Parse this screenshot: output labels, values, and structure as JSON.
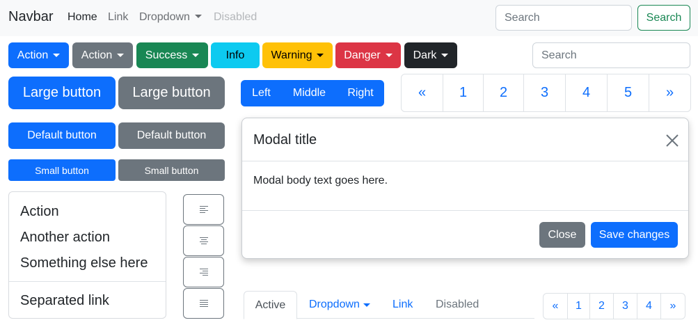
{
  "navbar": {
    "brand": "Navbar",
    "links": [
      {
        "label": "Home",
        "state": "active"
      },
      {
        "label": "Link",
        "state": "normal"
      },
      {
        "label": "Dropdown",
        "state": "dropdown"
      },
      {
        "label": "Disabled",
        "state": "disabled"
      }
    ],
    "search_placeholder": "Search",
    "search_button": "Search"
  },
  "dropdown_buttons": [
    "Action",
    "Action",
    "Success",
    "Info",
    "Warning",
    "Danger",
    "Dark"
  ],
  "search2_placeholder": "Search",
  "sized_buttons": {
    "large_primary": "Large button",
    "large_secondary": "Large button",
    "default_primary": "Default button",
    "default_secondary": "Default button",
    "small_primary": "Small button",
    "small_secondary": "Small button"
  },
  "button_group": [
    "Left",
    "Middle",
    "Right"
  ],
  "pagination_large": [
    "«",
    "1",
    "2",
    "3",
    "4",
    "5",
    "»"
  ],
  "pagination_small": [
    "«",
    "1",
    "2",
    "3",
    "4",
    "»"
  ],
  "dropdown_menu": {
    "items": [
      "Action",
      "Another action",
      "Something else here"
    ],
    "separated": "Separated link"
  },
  "align_icons": [
    "align-left-icon",
    "align-center-icon",
    "align-right-icon",
    "align-justify-icon"
  ],
  "modal": {
    "title": "Modal title",
    "body": "Modal body text goes here.",
    "close_label": "Close",
    "save_label": "Save changes"
  },
  "tabs": [
    {
      "label": "Active",
      "state": "active"
    },
    {
      "label": "Dropdown",
      "state": "dropdown"
    },
    {
      "label": "Link",
      "state": "normal"
    },
    {
      "label": "Disabled",
      "state": "disabled"
    }
  ],
  "colors": {
    "primary": "#0d6efd",
    "secondary": "#6c757d",
    "success": "#198754",
    "info": "#0dcaf0",
    "warning": "#ffc107",
    "danger": "#dc3545",
    "dark": "#212529"
  }
}
